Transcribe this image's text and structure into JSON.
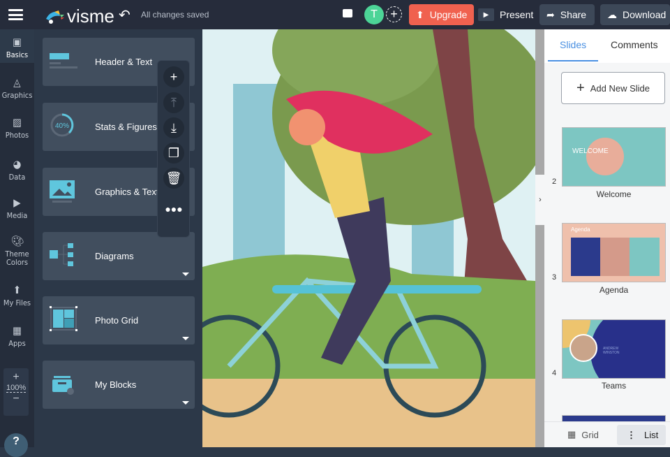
{
  "header": {
    "logo": "visme",
    "status": "All changes saved",
    "avatar_initial": "T",
    "upgrade": "Upgrade",
    "present": "Present",
    "share": "Share",
    "download": "Download"
  },
  "rail": {
    "items": [
      {
        "label": "Basics",
        "icon": "abc-blocks-icon"
      },
      {
        "label": "Graphics",
        "icon": "shapes-icon"
      },
      {
        "label": "Photos",
        "icon": "image-icon"
      },
      {
        "label": "Data",
        "icon": "pie-chart-icon"
      },
      {
        "label": "Media",
        "icon": "media-icon"
      },
      {
        "label": "Theme Colors",
        "icon": "palette-icon"
      },
      {
        "label": "My Files",
        "icon": "folder-upload-icon"
      },
      {
        "label": "Apps",
        "icon": "apps-grid-icon"
      }
    ],
    "zoom": "100%",
    "help": "?"
  },
  "panel": {
    "cards": [
      {
        "label": "Header & Text"
      },
      {
        "label": "Stats & Figures",
        "badge": "40%"
      },
      {
        "label": "Graphics & Text"
      },
      {
        "label": "Diagrams"
      },
      {
        "label": "Photo Grid"
      },
      {
        "label": "My Blocks"
      }
    ]
  },
  "right": {
    "tabs": [
      "Slides",
      "Comments"
    ],
    "add_slide": "Add New Slide",
    "slides": [
      {
        "num": "2",
        "title": "Welcome",
        "thumb_text": "WELCOME"
      },
      {
        "num": "3",
        "title": "Agenda",
        "thumb_text": "Agenda"
      },
      {
        "num": "4",
        "title": "Teams",
        "thumb_text": "ANDREW WINSTON"
      }
    ],
    "grid": "Grid",
    "list": "List"
  },
  "colors": {
    "accent": "#4a90e2",
    "upgrade": "#f0614f",
    "avatar": "#4cd497",
    "topbar": "#262c3b"
  }
}
